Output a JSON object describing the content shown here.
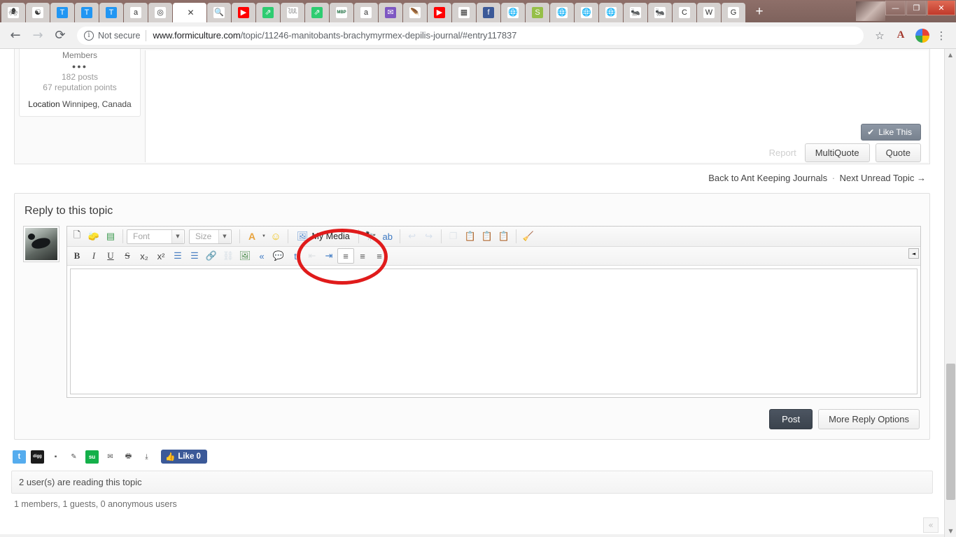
{
  "browser": {
    "tabs": [
      {
        "name": "tab-favicon-spider",
        "glyph": "🕷",
        "bg": "#ffffff",
        "active": false
      },
      {
        "name": "tab-favicon-yinyang",
        "glyph": "☯",
        "bg": "#ffffff",
        "active": false
      },
      {
        "name": "tab-favicon-t-blue-1",
        "glyph": "T",
        "bg": "#2196f3",
        "active": false
      },
      {
        "name": "tab-favicon-t-blue-2",
        "glyph": "T",
        "bg": "#2196f3",
        "active": false
      },
      {
        "name": "tab-favicon-t-blue-3",
        "glyph": "T",
        "bg": "#2196f3",
        "active": false
      },
      {
        "name": "tab-favicon-amazon",
        "glyph": "a",
        "bg": "#ffffff",
        "active": false
      },
      {
        "name": "tab-favicon-target",
        "glyph": "◎",
        "bg": "#ffffff",
        "active": false
      },
      {
        "name": "tab-formiculture-active",
        "glyph": "",
        "title": "",
        "bg": "#ffffff",
        "active": true
      },
      {
        "name": "tab-favicon-search",
        "glyph": "🔍",
        "bg": "#ffffff",
        "active": false
      },
      {
        "name": "tab-favicon-youtube-1",
        "glyph": "▶",
        "bg": "#ff0000",
        "active": false
      },
      {
        "name": "tab-favicon-green-1",
        "glyph": "⇗",
        "bg": "#2ecc71",
        "active": false
      },
      {
        "name": "tab-favicon-snake",
        "glyph": "𓆙",
        "bg": "#ffffff",
        "active": false
      },
      {
        "name": "tab-favicon-green-2",
        "glyph": "⇗",
        "bg": "#2ecc71",
        "active": false
      },
      {
        "name": "tab-favicon-mbp",
        "glyph": "MBP",
        "bg": "#ffffff",
        "active": false
      },
      {
        "name": "tab-favicon-amazon-2",
        "glyph": "a",
        "bg": "#ffffff",
        "active": false
      },
      {
        "name": "tab-favicon-mail",
        "glyph": "✉",
        "bg": "#7e57c2",
        "active": false
      },
      {
        "name": "tab-favicon-feather",
        "glyph": "🪶",
        "bg": "#ffffff",
        "active": false
      },
      {
        "name": "tab-favicon-youtube-2",
        "glyph": "▶",
        "bg": "#ff0000",
        "active": false
      },
      {
        "name": "tab-favicon-grey-art",
        "glyph": "▦",
        "bg": "#ffffff",
        "active": false
      },
      {
        "name": "tab-favicon-facebook",
        "glyph": "f",
        "bg": "#3b5998",
        "active": false
      },
      {
        "name": "tab-favicon-globe-1",
        "glyph": "🌐",
        "bg": "#ffffff",
        "active": false
      },
      {
        "name": "tab-favicon-shopify",
        "glyph": "S",
        "bg": "#96bf48",
        "active": false
      },
      {
        "name": "tab-favicon-globe-2",
        "glyph": "🌐",
        "bg": "#ffffff",
        "active": false
      },
      {
        "name": "tab-favicon-globe-3",
        "glyph": "🌐",
        "bg": "#ffffff",
        "active": false
      },
      {
        "name": "tab-favicon-globe-4",
        "glyph": "🌐",
        "bg": "#ffffff",
        "active": false
      },
      {
        "name": "tab-favicon-ant-red",
        "glyph": "🐜",
        "bg": "#ffffff",
        "active": false
      },
      {
        "name": "tab-favicon-ant-black",
        "glyph": "🐜",
        "bg": "#ffffff",
        "active": false
      },
      {
        "name": "tab-favicon-c-red",
        "glyph": "C",
        "bg": "#ffffff",
        "active": false
      },
      {
        "name": "tab-favicon-wikipedia",
        "glyph": "W",
        "bg": "#ffffff",
        "active": false
      },
      {
        "name": "tab-favicon-google",
        "glyph": "G",
        "bg": "#ffffff",
        "active": false
      }
    ],
    "active_tab_close": "✕",
    "new_tab_label": "+",
    "window_controls": {
      "minimize": "—",
      "restore": "❐",
      "close": "✕"
    },
    "nav": {
      "back": "←",
      "forward": "→",
      "reload": "⟳"
    },
    "omnibox": {
      "security_icon": "i",
      "security_text": "Not secure",
      "url_host": "www.formiculture.com",
      "url_path": "/topic/11246-manitobants-brachymyrmex-depilis-journal/#entry117837"
    },
    "toolbar_icons": {
      "bookmark": "☆",
      "pdf": "A",
      "menu": "⋮"
    }
  },
  "post": {
    "member_group": "Members",
    "rank_dots": "●●●",
    "posts": "182 posts",
    "reputation": "67 reputation points",
    "location_label": "Location",
    "location_value": "Winnipeg, Canada",
    "like_button": "Like This",
    "like_check": "✔",
    "report": "Report",
    "multiquote": "MultiQuote",
    "quote": "Quote"
  },
  "topic_nav": {
    "back_link": "Back to Ant Keeping Journals",
    "separator": "·",
    "next_link": "Next Unread Topic  →"
  },
  "reply": {
    "title": "Reply to this topic",
    "toolbar_row1": [
      {
        "name": "source-code-button",
        "glyph": "🗋"
      },
      {
        "name": "eraser-button",
        "glyph": "🧽"
      },
      {
        "name": "table-button",
        "glyph": "▤"
      }
    ],
    "font_select": {
      "label": "Font",
      "arrow": "▼"
    },
    "size_select": {
      "label": "Size",
      "arrow": "▼"
    },
    "color_button": {
      "name": "font-color-button",
      "glyph": "A",
      "arrow": "▼"
    },
    "emoticon_button": {
      "name": "emoticon-button",
      "glyph": "☺"
    },
    "my_media": {
      "label": "My Media",
      "icon": "🖼"
    },
    "toolbar_row1b": [
      {
        "name": "find-replace-button",
        "glyph": "🔭"
      },
      {
        "name": "spellcheck-button",
        "glyph": "ab"
      },
      {
        "name": "undo-button",
        "glyph": "↩"
      },
      {
        "name": "redo-button",
        "glyph": "↪"
      },
      {
        "name": "copy-button",
        "glyph": "❐"
      },
      {
        "name": "paste-button",
        "glyph": "📋"
      },
      {
        "name": "paste-text-button",
        "glyph": "📋"
      },
      {
        "name": "paste-word-button",
        "glyph": "📋"
      },
      {
        "name": "remove-format-button",
        "glyph": "🧹"
      }
    ],
    "toolbar_row2": [
      {
        "name": "bold-button",
        "glyph": "B"
      },
      {
        "name": "italic-button",
        "glyph": "I"
      },
      {
        "name": "underline-button",
        "glyph": "U"
      },
      {
        "name": "strikethrough-button",
        "glyph": "S"
      },
      {
        "name": "subscript-button",
        "glyph": "x₂"
      },
      {
        "name": "superscript-button",
        "glyph": "x²"
      },
      {
        "name": "bullet-list-button",
        "glyph": "☰"
      },
      {
        "name": "numbered-list-button",
        "glyph": "☰"
      },
      {
        "name": "insert-link-button",
        "glyph": "🔗"
      },
      {
        "name": "unlink-button",
        "glyph": "⛓"
      },
      {
        "name": "insert-image-button",
        "glyph": "🖼"
      },
      {
        "name": "insert-media-button",
        "glyph": "«"
      },
      {
        "name": "quote-bubble-button",
        "glyph": "💬"
      },
      {
        "name": "twitter-embed-button",
        "glyph": "t"
      },
      {
        "name": "outdent-button",
        "glyph": "⇤"
      },
      {
        "name": "indent-button",
        "glyph": "⇥"
      },
      {
        "name": "align-left-button",
        "glyph": "≡"
      },
      {
        "name": "align-center-button",
        "glyph": "≡"
      },
      {
        "name": "align-right-button",
        "glyph": "≡"
      }
    ],
    "toolbar_collapse": "◄",
    "editor_value": "",
    "post_button": "Post",
    "more_options_button": "More Reply Options"
  },
  "share": [
    {
      "name": "share-twitter-icon",
      "glyph": "t",
      "bg": "#55acee"
    },
    {
      "name": "share-digg-icon",
      "glyph": "digg",
      "bg": "#1b1b1b"
    },
    {
      "name": "share-delicious-icon",
      "glyph": "▪",
      "bg": "#ffffff"
    },
    {
      "name": "share-reddit-icon",
      "glyph": "✎",
      "bg": "#ffffff"
    },
    {
      "name": "share-stumbleupon-icon",
      "glyph": "su",
      "bg": "#14b04a"
    },
    {
      "name": "share-email-icon",
      "glyph": "✉",
      "bg": "#ffffff"
    },
    {
      "name": "share-print-icon",
      "glyph": "🖶",
      "bg": "#ffffff"
    },
    {
      "name": "share-download-icon",
      "glyph": "⤓",
      "bg": "#ffffff"
    }
  ],
  "facebook_like": {
    "icon": "👍",
    "label": "Like 0"
  },
  "footer": {
    "reading": "2 user(s) are reading this topic",
    "readers": "1 members, 1 guests, 0 anonymous users",
    "collapse_glyph": "«"
  },
  "annotation": {
    "shape": "ellipse",
    "color": "#e01b1b",
    "target": "my-media-button"
  }
}
